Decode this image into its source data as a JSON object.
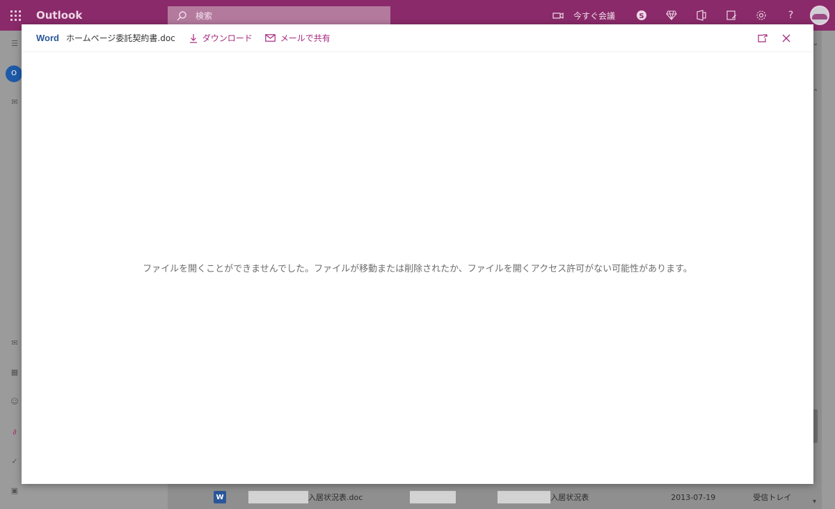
{
  "app": {
    "name": "Outlook"
  },
  "search": {
    "placeholder": "検索"
  },
  "topbar": {
    "meet_now_label": "今すぐ会議",
    "help_label": "?"
  },
  "viewer": {
    "app_label": "Word",
    "file_name": "ホームページ委託契約書.doc",
    "download_label": "ダウンロード",
    "share_label": "メールで共有",
    "error_message": "ファイルを開くことができませんでした。ファイルが移動または削除されたか、ファイルを開くアクセス許可がない可能性があります。"
  },
  "background_row": {
    "file_name": "入居状況表.doc",
    "subject": "入居状況表",
    "date": "2013-07-19",
    "folder": "受信トレイ"
  },
  "colors": {
    "brand": "#8a2a6a",
    "accent": "#a4267d",
    "word": "#2b579a"
  }
}
